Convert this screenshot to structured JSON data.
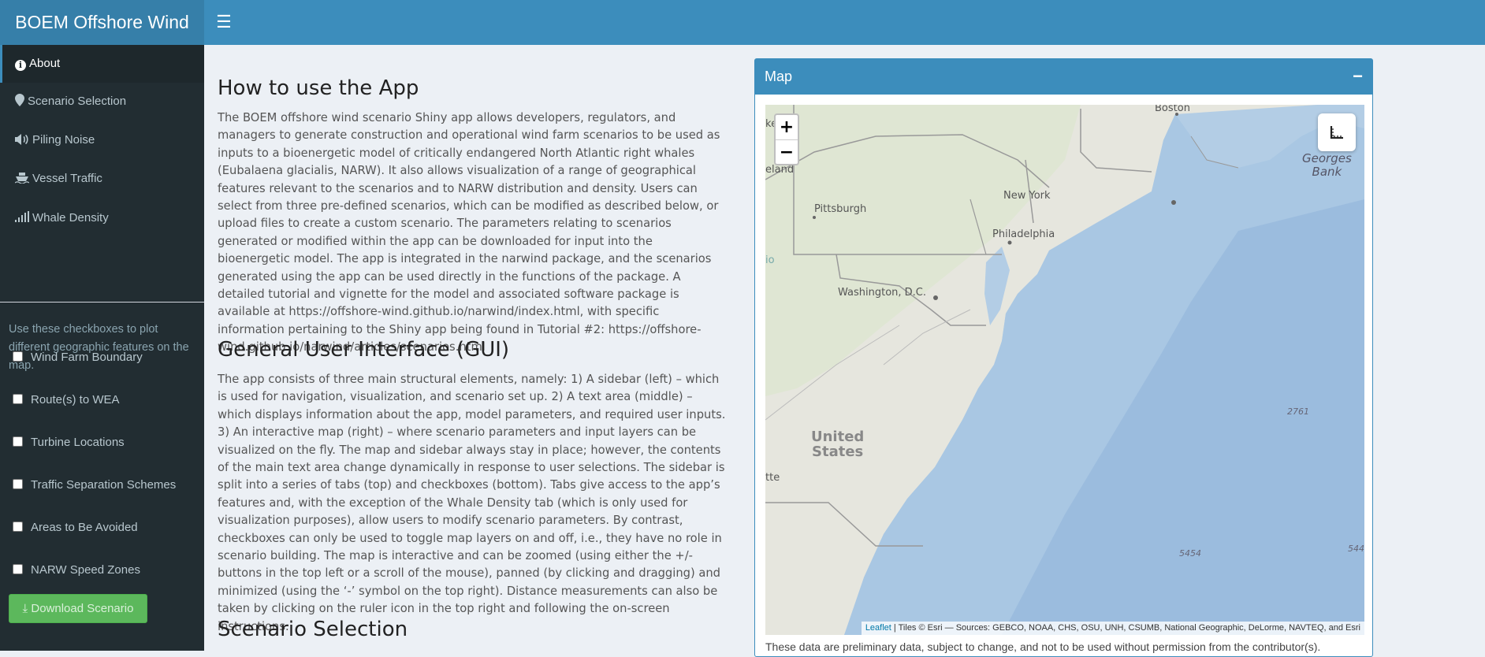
{
  "app": {
    "title": "BOEM Offshore Wind",
    "menu_icon": "hamburger-icon"
  },
  "sidebar": {
    "items": [
      {
        "label": "About",
        "icon": "info-circle-icon",
        "active": true
      },
      {
        "label": "Scenario Selection",
        "icon": "map-marker-icon",
        "active": false
      },
      {
        "label": "Piling Noise",
        "icon": "volume-up-icon",
        "active": false
      },
      {
        "label": "Vessel Traffic",
        "icon": "ship-icon",
        "active": false
      },
      {
        "label": "Whale Density",
        "icon": "signal-icon",
        "active": false
      }
    ],
    "help_text": "Use these checkboxes to plot different geographic features on the map.",
    "checkboxes": [
      {
        "label": "Wind Farm Boundary",
        "checked": false
      },
      {
        "label": "Route(s) to WEA",
        "checked": false
      },
      {
        "label": "Turbine Locations",
        "checked": false
      },
      {
        "label": "Traffic Separation Schemes",
        "checked": false
      },
      {
        "label": "Areas to Be Avoided",
        "checked": false
      },
      {
        "label": "NARW Speed Zones",
        "checked": false
      }
    ],
    "download_label": "Download Scenario"
  },
  "main": {
    "sections": [
      {
        "title": "How to use the App",
        "text": "The BOEM offshore wind scenario Shiny app allows developers, regulators, and managers to generate construction and operational wind farm scenarios to be used as inputs to a bioenergetic model of critically endangered North Atlantic right whales (Eubalaena glacialis, NARW). It also allows visualization of a range of geographical features relevant to the scenarios and to NARW distribution and density. Users can select from three pre-defined scenarios, which can be modified as described below, or upload files to create a custom scenario. The parameters relating to scenarios generated or modified within the app can be downloaded for input into the bioenergetic model. The app is integrated in the narwind package, and the scenarios generated using the app can be used directly in the functions of the package. A detailed tutorial and vignette for the model and associated software package is available at https://offshore-wind.github.io/narwind/index.html, with specific information pertaining to the Shiny app being found in Tutorial #2: https://offshore-wind.github.io/narwind/articles/scenarios.html"
      },
      {
        "title": "General User Interface (GUI)",
        "text": "The app consists of three main structural elements, namely: 1) A sidebar (left) – which is used for navigation, visualization, and scenario set up. 2) A text area (middle) – which displays information about the app, model parameters, and required user inputs. 3) An interactive map (right) – where scenario parameters and input layers can be visualized on the fly. The map and sidebar always stay in place; however, the contents of the main text area change dynamically in response to user selections. The sidebar is split into a series of tabs (top) and checkboxes (bottom). Tabs give access to the app’s features and, with the exception of the Whale Density tab (which is only used for visualization purposes), allow users to modify scenario parameters. By contrast, checkboxes can only be used to toggle map layers on and off, i.e., they have no role in scenario building. The map is interactive and can be zoomed (using either the +/- buttons in the top left or a scroll of the mouse), panned (by clicking and dragging) and minimized (using the ‘-’ symbol on the top right). Distance measurements can also be taken by clicking on the ruler icon in the top right and following the on-screen instructions."
      },
      {
        "title": "Scenario Selection",
        "text": ""
      }
    ]
  },
  "map_panel": {
    "title": "Map",
    "collapse_label": "−",
    "zoom_in": "+",
    "zoom_out": "−",
    "ruler_icon": "ruler-icon",
    "labels": {
      "boston": "Boston",
      "new_york": "New York",
      "philadelphia": "Philadelphia",
      "pittsburgh": "Pittsburgh",
      "washington": "Washington, D.C.",
      "united_states_1": "United",
      "united_states_2": "States",
      "georges_bank_1": "Georges",
      "georges_bank_2": "Bank",
      "depth_1": "2761",
      "depth_2": "5454",
      "depth_3": "544",
      "cut_1": "ke",
      "cut_2": "eland",
      "cut_3": "io",
      "cut_4": "tte"
    },
    "attribution_link": "Leaflet",
    "attribution_text": " | Tiles © Esri — Sources: GEBCO, NOAA, CHS, OSU, UNH, CSUMB, National Geographic, DeLorme, NAVTEQ, and Esri",
    "disclaimer": "These data are preliminary data, subject to change, and not to be used without permission from the contributor(s)."
  },
  "colors": {
    "header": "#3c8dbc",
    "brand": "#367fa9",
    "sidebar": "#222d32",
    "download": "#5cb85c"
  }
}
